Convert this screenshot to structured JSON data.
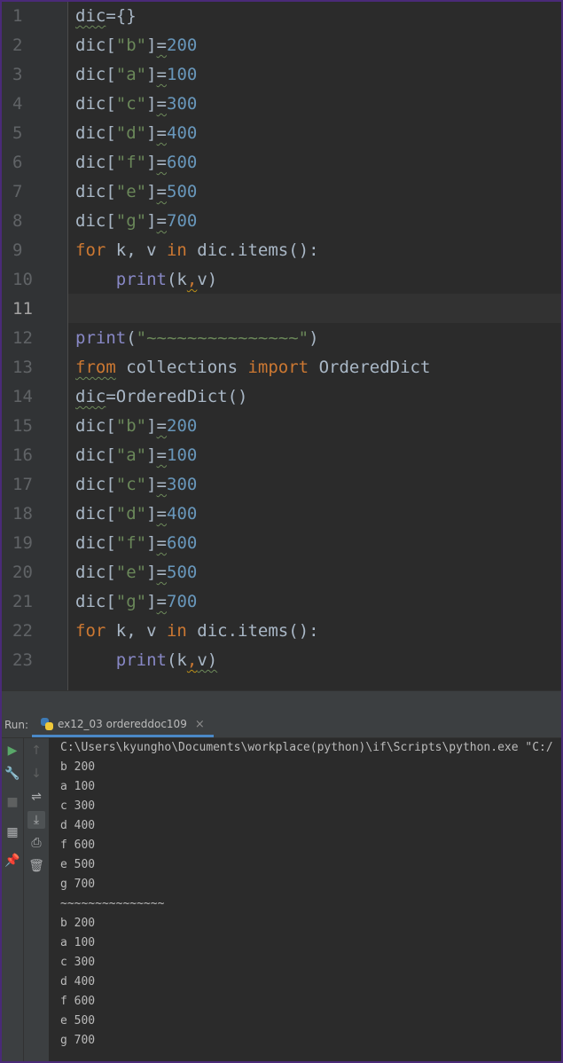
{
  "editor": {
    "current_line": 11,
    "line_numbers": [
      "1",
      "2",
      "3",
      "4",
      "5",
      "6",
      "7",
      "8",
      "9",
      "10",
      "11",
      "12",
      "13",
      "14",
      "15",
      "16",
      "17",
      "18",
      "19",
      "20",
      "21",
      "22",
      "23"
    ]
  },
  "code": {
    "l1": {
      "a": "dic",
      "b": "={}"
    },
    "l2": {
      "a": "dic[",
      "s": "\"b\"",
      "c": "]",
      "eq": "=",
      "n": "200"
    },
    "l3": {
      "a": "dic[",
      "s": "\"a\"",
      "c": "]",
      "eq": "=",
      "n": "100"
    },
    "l4": {
      "a": "dic[",
      "s": "\"c\"",
      "c": "]",
      "eq": "=",
      "n": "300"
    },
    "l5": {
      "a": "dic[",
      "s": "\"d\"",
      "c": "]",
      "eq": "=",
      "n": "400"
    },
    "l6": {
      "a": "dic[",
      "s": "\"f\"",
      "c": "]",
      "eq": "=",
      "n": "600"
    },
    "l7": {
      "a": "dic[",
      "s": "\"e\"",
      "c": "]",
      "eq": "=",
      "n": "500"
    },
    "l8": {
      "a": "dic[",
      "s": "\"g\"",
      "c": "]",
      "eq": "=",
      "n": "700"
    },
    "l9": {
      "k1": "for",
      "t1": " k, v ",
      "k2": "in",
      "t2": " dic.items():"
    },
    "l10": {
      "indent": "    ",
      "f": "print",
      "t1": "(k",
      "comma": ",",
      "t2": "v)"
    },
    "l12": {
      "f": "print",
      "t1": "(",
      "s": "\"~~~~~~~~~~~~~~~\"",
      "t2": ")"
    },
    "l13": {
      "k1": "from",
      "t1": " collections ",
      "k2": "import",
      "t2": " OrderedDict"
    },
    "l14": {
      "a": "dic",
      "b": "=OrderedDict()"
    },
    "l15": {
      "a": "dic[",
      "s": "\"b\"",
      "c": "]",
      "eq": "=",
      "n": "200"
    },
    "l16": {
      "a": "dic[",
      "s": "\"a\"",
      "c": "]",
      "eq": "=",
      "n": "100"
    },
    "l17": {
      "a": "dic[",
      "s": "\"c\"",
      "c": "]",
      "eq": "=",
      "n": "300"
    },
    "l18": {
      "a": "dic[",
      "s": "\"d\"",
      "c": "]",
      "eq": "=",
      "n": "400"
    },
    "l19": {
      "a": "dic[",
      "s": "\"f\"",
      "c": "]",
      "eq": "=",
      "n": "600"
    },
    "l20": {
      "a": "dic[",
      "s": "\"e\"",
      "c": "]",
      "eq": "=",
      "n": "500"
    },
    "l21": {
      "a": "dic[",
      "s": "\"g\"",
      "c": "]",
      "eq": "=",
      "n": "700"
    },
    "l22": {
      "k1": "for",
      "t1": " k, v ",
      "k2": "in",
      "t2": " dic.items():"
    },
    "l23": {
      "indent": "    ",
      "f": "print",
      "t1": "(k",
      "comma": ",",
      "t2": "v)"
    }
  },
  "run": {
    "label": "Run:",
    "tab_name": "ex12_03 ordereddoc109",
    "close_glyph": "×"
  },
  "toolbar_left": {
    "run_icon": "▶",
    "wrench_icon": "🔧",
    "stop_icon": "■",
    "layout_icon": "▦",
    "pin_icon": "📌"
  },
  "toolbar_right": {
    "up_icon": "↑",
    "down_icon": "↓",
    "wrap_icon": "⇌",
    "scroll_end_icon": "⤓",
    "print_icon": "⎙",
    "trash_icon": "🗑"
  },
  "console": {
    "lines": [
      "C:\\Users\\kyungho\\Documents\\workplace(python)\\if\\Scripts\\python.exe \"C:/",
      "b 200",
      "a 100",
      "c 300",
      "d 400",
      "f 600",
      "e 500",
      "g 700",
      "~~~~~~~~~~~~~~~",
      "b 200",
      "a 100",
      "c 300",
      "d 400",
      "f 600",
      "e 500",
      "g 700"
    ]
  },
  "colors": {
    "keyword": "#cc7832",
    "string": "#6a8759",
    "number": "#6897bb",
    "builtin": "#8888c6",
    "text": "#a9b7c6",
    "window_border": "#4a2a78"
  }
}
